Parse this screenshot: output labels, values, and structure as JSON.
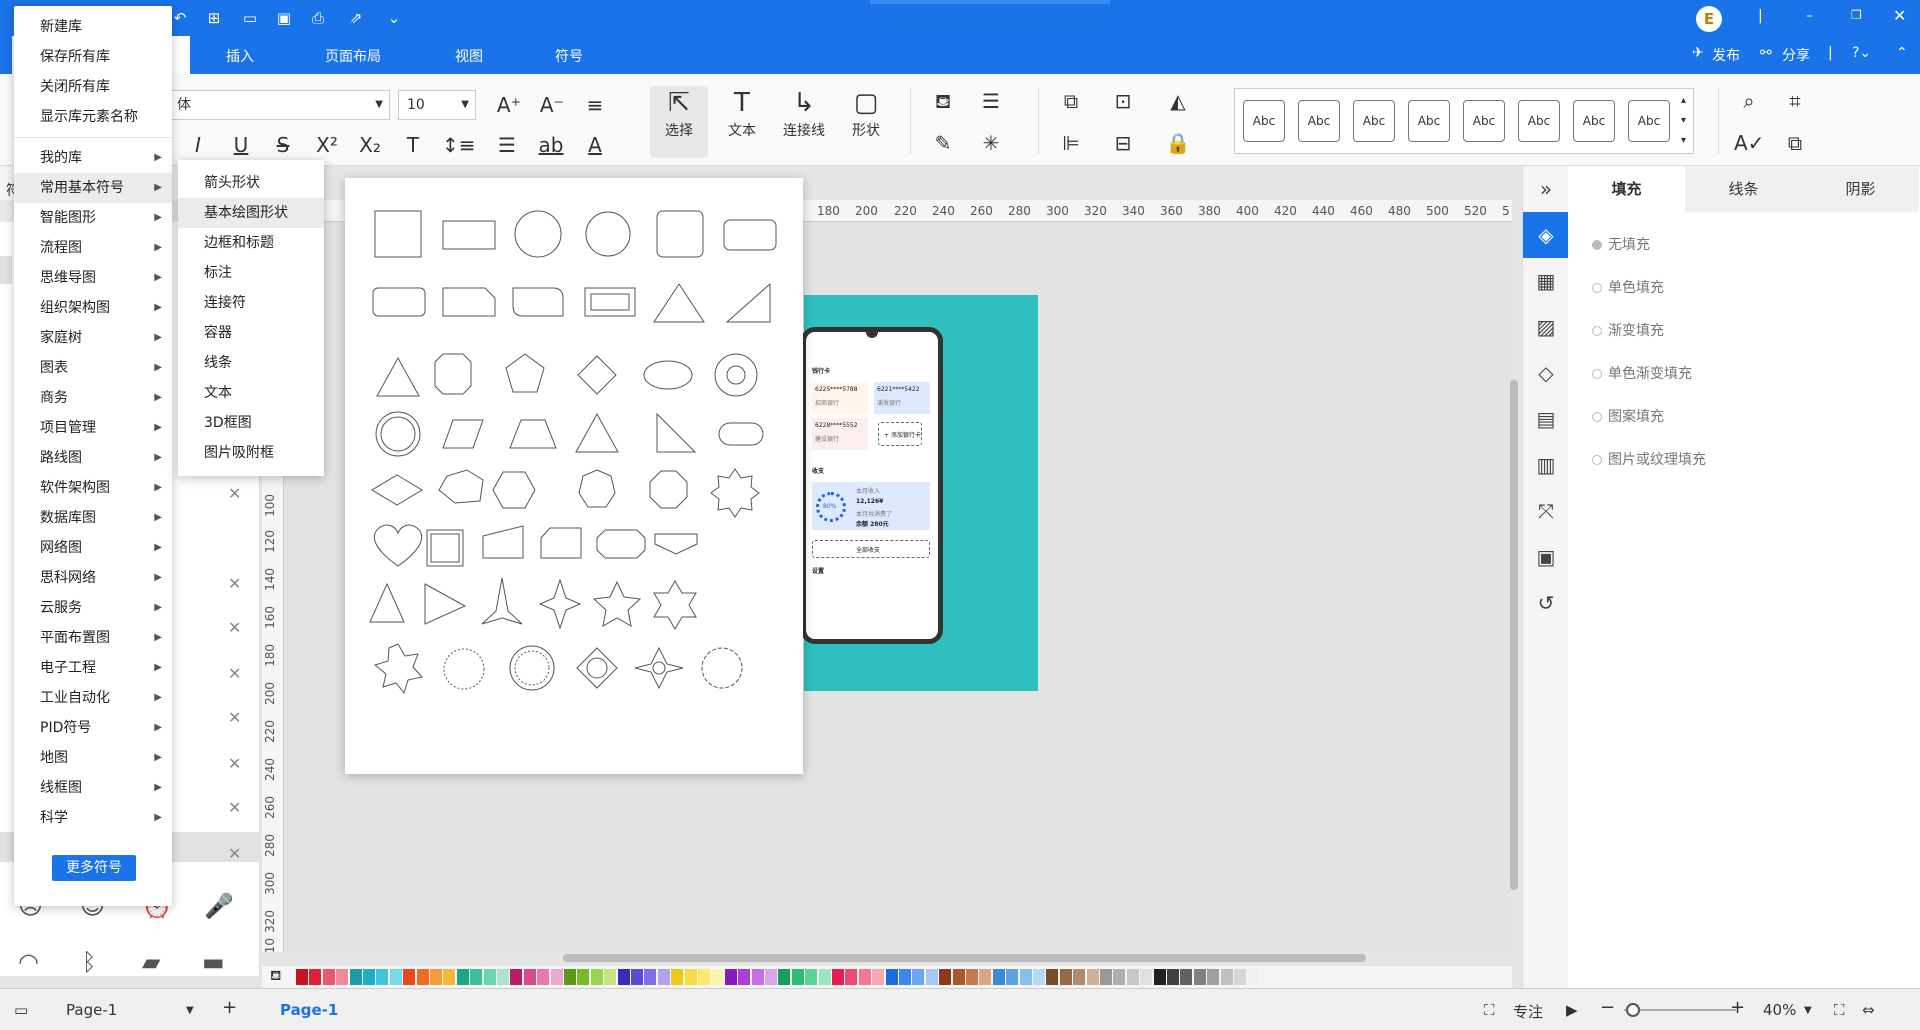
{
  "ribbon": {
    "tabs": [
      "插入",
      "页面布局",
      "视图",
      "符号"
    ],
    "publish": "发布",
    "share": "分享",
    "avatar": "E"
  },
  "toolbar": {
    "font_name": "体",
    "font_size": "10",
    "select": "选择",
    "text": "文本",
    "connector": "连接线",
    "shape": "形状",
    "style_sample": "Abc",
    "partial_tab": "通用"
  },
  "library_menu": {
    "top_items": [
      "新建库",
      "保存所有库",
      "关闭所有库",
      "显示库元素名称"
    ],
    "items": [
      "我的库",
      "常用基本符号",
      "智能图形",
      "流程图",
      "思维导图",
      "组织架构图",
      "家庭树",
      "图表",
      "商务",
      "项目管理",
      "路线图",
      "软件架构图",
      "数据库图",
      "网络图",
      "思科网络",
      "云服务",
      "平面布置图",
      "电子工程",
      "工业自动化",
      "PID符号",
      "地图",
      "线框图",
      "科学"
    ],
    "more_button": "更多符号"
  },
  "sub_menu": {
    "items": [
      "箭头形状",
      "基本绘图形状",
      "边框和标题",
      "标注",
      "连接符",
      "容器",
      "线条",
      "文本",
      "3D框图",
      "图片吸附框"
    ]
  },
  "left_panel": {
    "partial_label": "符"
  },
  "ruler": {
    "top_ticks": [
      "180",
      "200",
      "220",
      "240",
      "260",
      "280",
      "300",
      "320",
      "340",
      "360",
      "380",
      "400",
      "420",
      "440",
      "460",
      "480",
      "500",
      "520",
      "5"
    ],
    "left_ticks": [
      "100",
      "120",
      "140",
      "160",
      "180",
      "200",
      "220",
      "240",
      "260",
      "280",
      "300",
      "320",
      "10"
    ]
  },
  "phone_screen": {
    "header": "钱行卡",
    "card1": "6225****5788",
    "card2": "6221****5422",
    "card3": "6228****5552",
    "bank1": "招商银行",
    "bank2": "浦发银行",
    "bank3": "建设银行",
    "add": "+ 添加银行卡",
    "section": "收支",
    "ring_value": "80%",
    "income_label": "本月收入",
    "amount": "12,126¥",
    "spend_label": "本月共消费了",
    "spend": "余额 280元",
    "button": "全部收支",
    "footer": "设置"
  },
  "properties": {
    "tabs": [
      "填充",
      "线条",
      "阴影"
    ],
    "options": [
      "无填充",
      "单色填充",
      "渐变填充",
      "单色渐变填充",
      "图案填充",
      "图片或纹理填充"
    ]
  },
  "status": {
    "page_select": "Page-1",
    "page_tab": "Page-1",
    "focus": "专注",
    "zoom": "40%"
  },
  "colors": {
    "accent": "#1a73e8",
    "page_fill": "#2fbfbf"
  }
}
